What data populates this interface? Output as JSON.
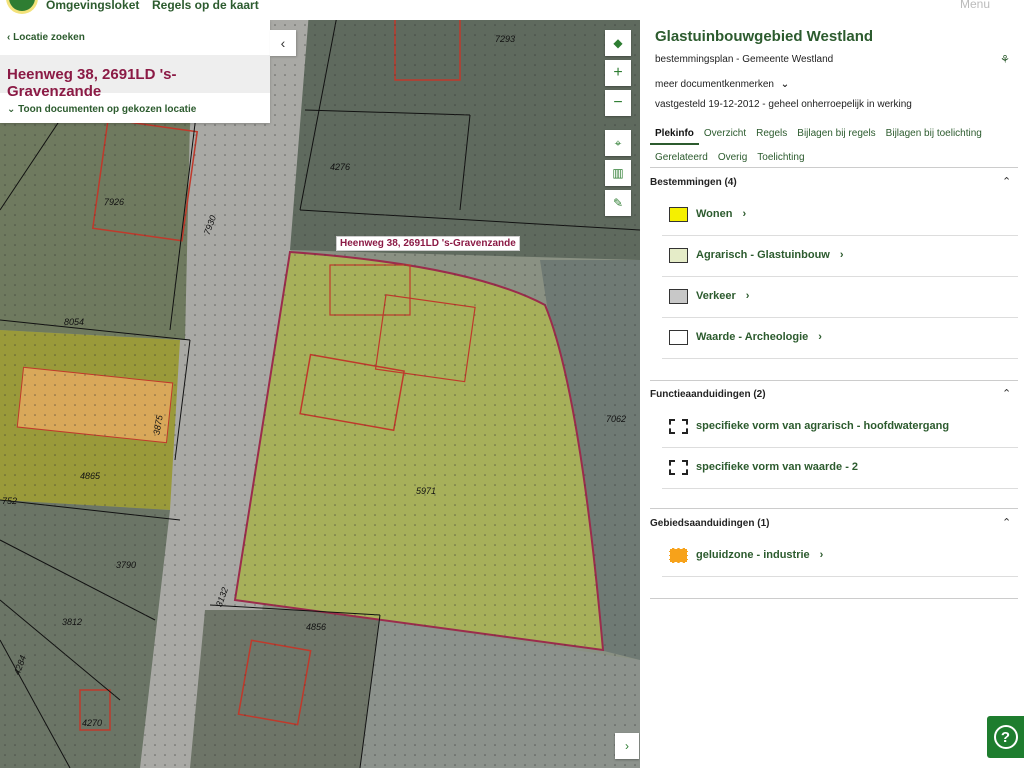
{
  "topbar": {
    "tab1": "Omgevingsloket",
    "tab2": "Regels op de kaart",
    "right": "Menu"
  },
  "left_panel": {
    "back": "Locatie zoeken",
    "address": "Heenweg 38, 2691LD 's-Gravenzande",
    "toon": "Toon documenten op gekozen locatie"
  },
  "map": {
    "label": "Heenweg 38, 2691LD 's-Gravenzande",
    "parcels": [
      {
        "text": "7293"
      },
      {
        "text": "4276"
      },
      {
        "text": "7926"
      },
      {
        "text": "7930"
      },
      {
        "text": "8054"
      },
      {
        "text": "3875"
      },
      {
        "text": "4865"
      },
      {
        "text": "752"
      },
      {
        "text": "3790"
      },
      {
        "text": "3812"
      },
      {
        "text": "5971"
      },
      {
        "text": "7062"
      },
      {
        "text": "4856"
      },
      {
        "text": "3132"
      },
      {
        "text": "4284"
      },
      {
        "text": "4270"
      }
    ]
  },
  "panel": {
    "title": "Glastuinbouwgebied Westland",
    "subtitle": "bestemmingsplan - Gemeente Westland",
    "meer": "meer documentkenmerken",
    "vastgesteld": "vastgesteld 19-12-2012 - geheel onherroepelijk in werking",
    "tabs": [
      "Plekinfo",
      "Overzicht",
      "Regels",
      "Bijlagen bij regels",
      "Bijlagen bij toelichting"
    ],
    "tabs2": [
      "Gerelateerd",
      "Overig",
      "Toelichting"
    ],
    "bestemmingen": {
      "header": "Bestemmingen (4)",
      "items": [
        {
          "label": "Wonen",
          "color": "#f5f000"
        },
        {
          "label": "Agrarisch - Glastuinbouw",
          "color": "#e5ecc8"
        },
        {
          "label": "Verkeer",
          "color": "#c8c8c8"
        },
        {
          "label": "Waarde - Archeologie",
          "color": "#ffffff"
        }
      ]
    },
    "functie": {
      "header": "Functieaanduidingen (2)",
      "items": [
        {
          "label": "specifieke vorm van agrarisch - hoofdwatergang"
        },
        {
          "label": "specifieke vorm van waarde - 2"
        }
      ]
    },
    "gebied": {
      "header": "Gebiedsaanduidingen (1)",
      "items": [
        {
          "label": "geluidzone - industrie",
          "color": "#f7a21a"
        }
      ]
    }
  }
}
